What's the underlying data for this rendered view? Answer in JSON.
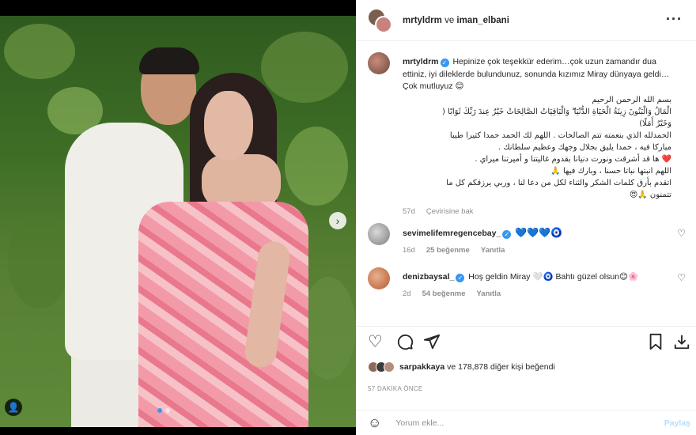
{
  "photo": {
    "alt_icons": {
      "next": "chevron-right-icon",
      "tag": "user-tag-icon"
    },
    "carousel_dots": 2,
    "active_dot": 0
  },
  "header": {
    "user1": "mrtyldrm",
    "connector": "ve",
    "user2": "iman_elbani",
    "more_icon": "more-horizontal-icon"
  },
  "caption": {
    "username": "mrtyldrm",
    "text": "Hepinize çok teşekkür ederim…çok uzun zamandır dua ettiniz, iyi dileklerde bulundunuz, sonunda kızımız Miray dünyaya geldi…Çok mutluyuz 😊",
    "arabic_lines": [
      "بسم الله الرحمن الرحيم",
      "الْمَالُ وَالْبَنُونَ زِينَةُ الْحَيَاةِ الدُّنْيَا ۖ وَالْبَاقِيَاتُ الصَّالِحَاتُ خَيْرٌ عِندَ رَبِّكَ ثَوَابًا (",
      "وَخَيْرٌ أَمَلًا)",
      "الحمدلله الذي بنعمته تتم الصالحات . اللهم لك الحمد حمدا كثيرا طيبا",
      "مباركا فيه ، حمدا يليق بجلال وجهك وعظيم سلطانك .",
      "❤️ ها قد أشرقت ونورت دنيانا بقدوم غاليتنا و أميرتنا ميراي .",
      "اللهم انبتها نباتا حسنا ، وبارك فيها 🙏",
      "اتقدم بأرق كلمات الشكر والثناء لكل من دعا لنا ، وربي يرزقكم كل ما",
      "تتمنون 🙏😍"
    ],
    "age": "57d",
    "see_translation": "Çevirisine bak"
  },
  "comments": [
    {
      "username": "sevimelifemregencebay_",
      "text": "💙💙💙🧿",
      "age": "16d",
      "likes": "25 beğenme",
      "reply": "Yanıtla"
    },
    {
      "username": "denizbaysal_",
      "text": "Hoş geldin Miray 🤍🧿 Bahtı güzel olsun😊🌸",
      "age": "2d",
      "likes": "54 beğenme",
      "reply": "Yanıtla"
    }
  ],
  "actions": {
    "like_icon": "heart-icon",
    "comment_icon": "comment-icon",
    "share_icon": "send-icon",
    "save_icon": "bookmark-icon",
    "download_icon": "download-icon"
  },
  "likes": {
    "first_user": "sarpakkaya",
    "rest": "ve 178,878 diğer kişi beğendi"
  },
  "timestamp": "57 DAKİKA ÖNCE",
  "add_comment": {
    "placeholder": "Yorum ekle...",
    "post_label": "Paylaş"
  },
  "colors": {
    "accent_blue": "#3897f0",
    "muted": "#8e8e8e",
    "post_disabled": "#b2dffc"
  }
}
